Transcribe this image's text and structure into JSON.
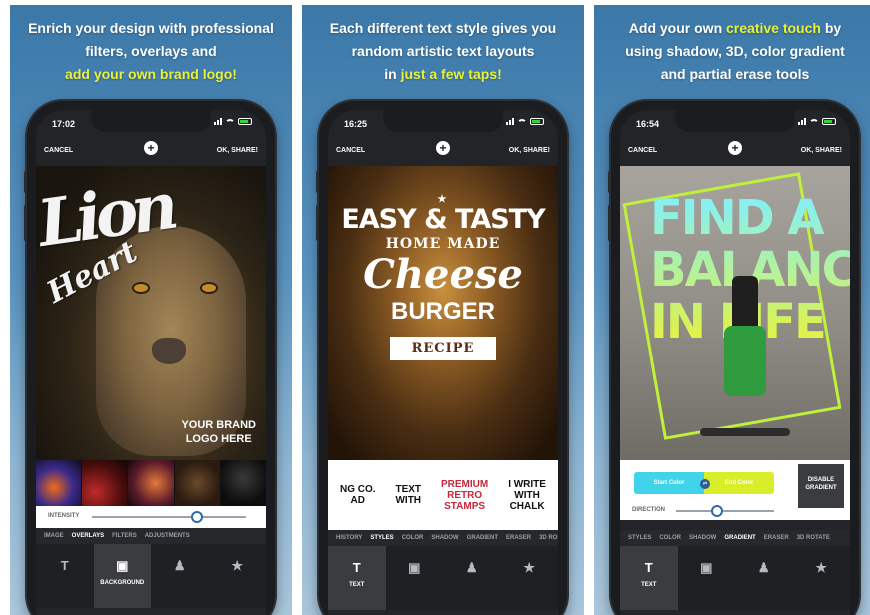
{
  "panels": [
    {
      "caption_lines": [
        "Enrich your design with professional",
        "filters, overlays and"
      ],
      "caption_highlight": "add your own brand logo!",
      "time": "17:02",
      "cancel": "CANCEL",
      "ok": "OK, SHARE!",
      "art_text": [
        "Lion",
        "Heart"
      ],
      "brand": [
        "YOUR BRAND",
        "LOGO HERE"
      ],
      "slider_label": "INTENSITY",
      "slider_value": 0.68,
      "tabs": [
        "IMAGE",
        "OVERLAYS",
        "FILTERS",
        "ADJUSTMENTS"
      ],
      "active_tab": "OVERLAYS",
      "nav_label": "BACKGROUND"
    },
    {
      "caption_lines": [
        "Each different text style gives you",
        "random artistic text layouts"
      ],
      "caption_prefix": "in ",
      "caption_highlight": "just a few taps!",
      "time": "16:25",
      "cancel": "CANCEL",
      "ok": "OK, SHARE!",
      "overlay": [
        "★",
        "EASY & TASTY",
        "HOME MADE",
        "Cheese",
        "BURGER",
        "RECIPE"
      ],
      "style_samples": [
        "NG CO.\nAD",
        "TEXT\nWITH",
        "PREMIUM\nRETRO\nSTAMPS",
        "I WRITE\nWITH\nCHALK"
      ],
      "tabs": [
        "HISTORY",
        "STYLES",
        "COLOR",
        "SHADOW",
        "GRADIENT",
        "ERASER",
        "3D RO"
      ],
      "active_tab": "STYLES",
      "nav_label": "TEXT"
    },
    {
      "caption_prefix": "Add your own ",
      "caption_highlight": "creative touch",
      "caption_suffix": " by",
      "caption_lines": [
        "using shadow, 3D, color gradient",
        "and partial erase tools"
      ],
      "time": "16:54",
      "cancel": "CANCEL",
      "ok": "OK, SHARE!",
      "art_lines": [
        "FIND A",
        "BALANCE",
        "IN LIFE"
      ],
      "start_color": "Start Color",
      "end_color": "End Color",
      "disable": "DISABLE GRADIENT",
      "slider_label": "DIRECTION",
      "slider_value": 0.42,
      "tabs": [
        "STYLES",
        "COLOR",
        "SHADOW",
        "GRADIENT",
        "ERASER",
        "3D ROTATE"
      ],
      "active_tab": "GRADIENT",
      "nav_label": "TEXT"
    }
  ],
  "colors": {
    "highlight": "#e8f23a",
    "accent": "#2f6aa3",
    "gradient_start": "#3fd4ea",
    "gradient_end": "#d8ee2a"
  },
  "icons": [
    "plus-icon",
    "text-icon",
    "background-icon",
    "person-icon",
    "star-icon",
    "image-icon",
    "swap-icon"
  ]
}
